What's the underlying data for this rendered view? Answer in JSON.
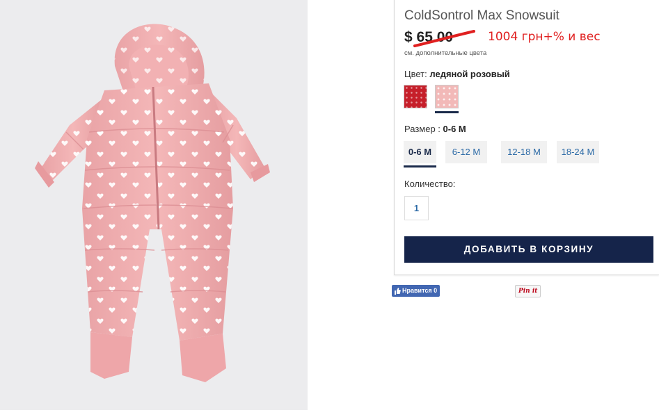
{
  "product": {
    "title": "ColdSontrol Max Snowsuit",
    "price": "$ 65.00",
    "note": "1004 грн+% и вес",
    "more_colors": "см. дополнительные цвета"
  },
  "color": {
    "label": "Цвет:",
    "selected": "ледяной розовый",
    "swatches": [
      {
        "name": "red-dots",
        "color": "#c61f2a"
      },
      {
        "name": "icy-pink",
        "color": "#f2b9b8"
      }
    ]
  },
  "size": {
    "label": "Размер :",
    "selected": "0-6 M",
    "options": [
      "0-6 M",
      "6-12 M",
      "12-18 M",
      "18-24 M"
    ]
  },
  "quantity": {
    "label": "Количество:",
    "value": "1"
  },
  "cart": {
    "button_label": "ДОБАВИТЬ В КОРЗИНУ"
  },
  "social": {
    "like_label": "Нравится 0",
    "pin_label": "Pin it"
  }
}
